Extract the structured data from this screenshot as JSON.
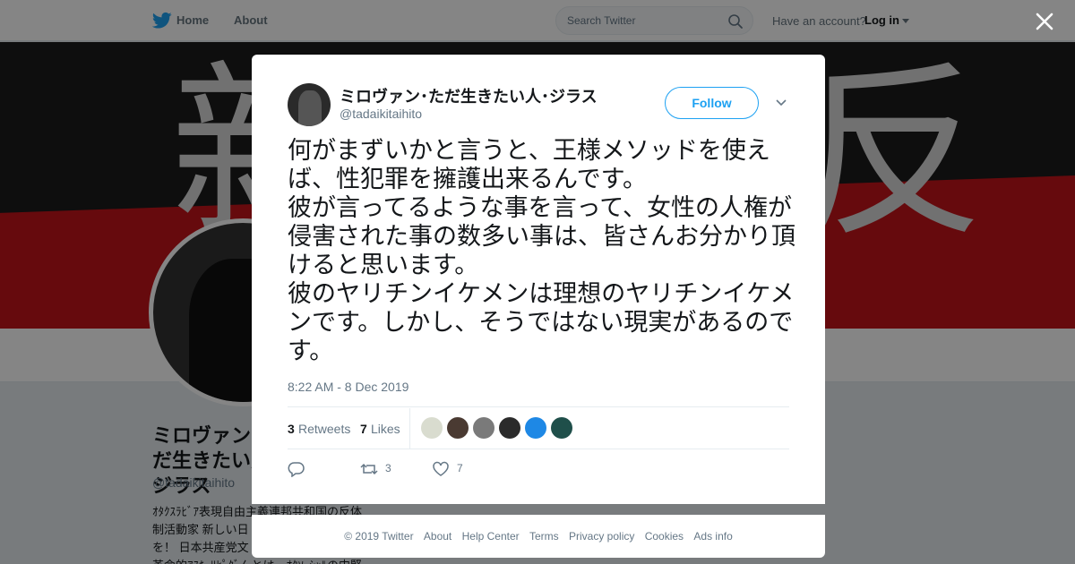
{
  "nav": {
    "home_label": "Home",
    "about_label": "About",
    "search_placeholder": "Search Twitter",
    "have_account": "Have an account?",
    "login_label": "Log in"
  },
  "profile": {
    "name": "ミロヴァン･ただ生きたい人･ジラス",
    "handle": "@tadaikitaihito",
    "bio": "ｵﾀｸｽﾗﾋﾞｱ表現自由主義連邦共和国の反体\n制活動家 新しい日\nを！ 日本共産党文\n革命的ｱｽｷｰﾘﾋﾟｸﾞんとは…ｵﾀｿｰｼｬﾙの中堅"
  },
  "tweet": {
    "author_name": "ミロヴァン･ただ生きたい人･ジラス",
    "author_handle": "@tadaikitaihito",
    "follow_label": "Follow",
    "text": "何がまずいかと言うと、王様メソッドを使えば、性犯罪を擁護出来るんです。\n彼が言ってるような事を言って、女性の人権が侵害された事の数多い事は、皆さんお分かり頂けると思います。\n彼のヤリチンイケメンは理想のヤリチンイケメンです。しかし、そうではない現実があるのです。",
    "timestamp": "8:22 AM - 8 Dec 2019",
    "retweets_count": "3",
    "retweets_label": "Retweets",
    "likes_count": "7",
    "likes_label": "Likes",
    "action_retweet_count": "3",
    "action_like_count": "7"
  },
  "likers": [
    {
      "name": "liker-1",
      "color": "#d9dccf"
    },
    {
      "name": "liker-2",
      "color": "#4a3a32"
    },
    {
      "name": "liker-3",
      "color": "#7a7a7a"
    },
    {
      "name": "liker-4",
      "color": "#2b2b2b"
    },
    {
      "name": "liker-5",
      "color": "#1e88e5"
    },
    {
      "name": "liker-6",
      "color": "#1f4f4a"
    }
  ],
  "footer": {
    "copyright": "© 2019 Twitter",
    "about": "About",
    "help": "Help Center",
    "terms": "Terms",
    "privacy": "Privacy policy",
    "cookies": "Cookies",
    "ads": "Ads info"
  },
  "colors": {
    "brand": "#1da1f2",
    "banner_red": "#c4141a"
  }
}
